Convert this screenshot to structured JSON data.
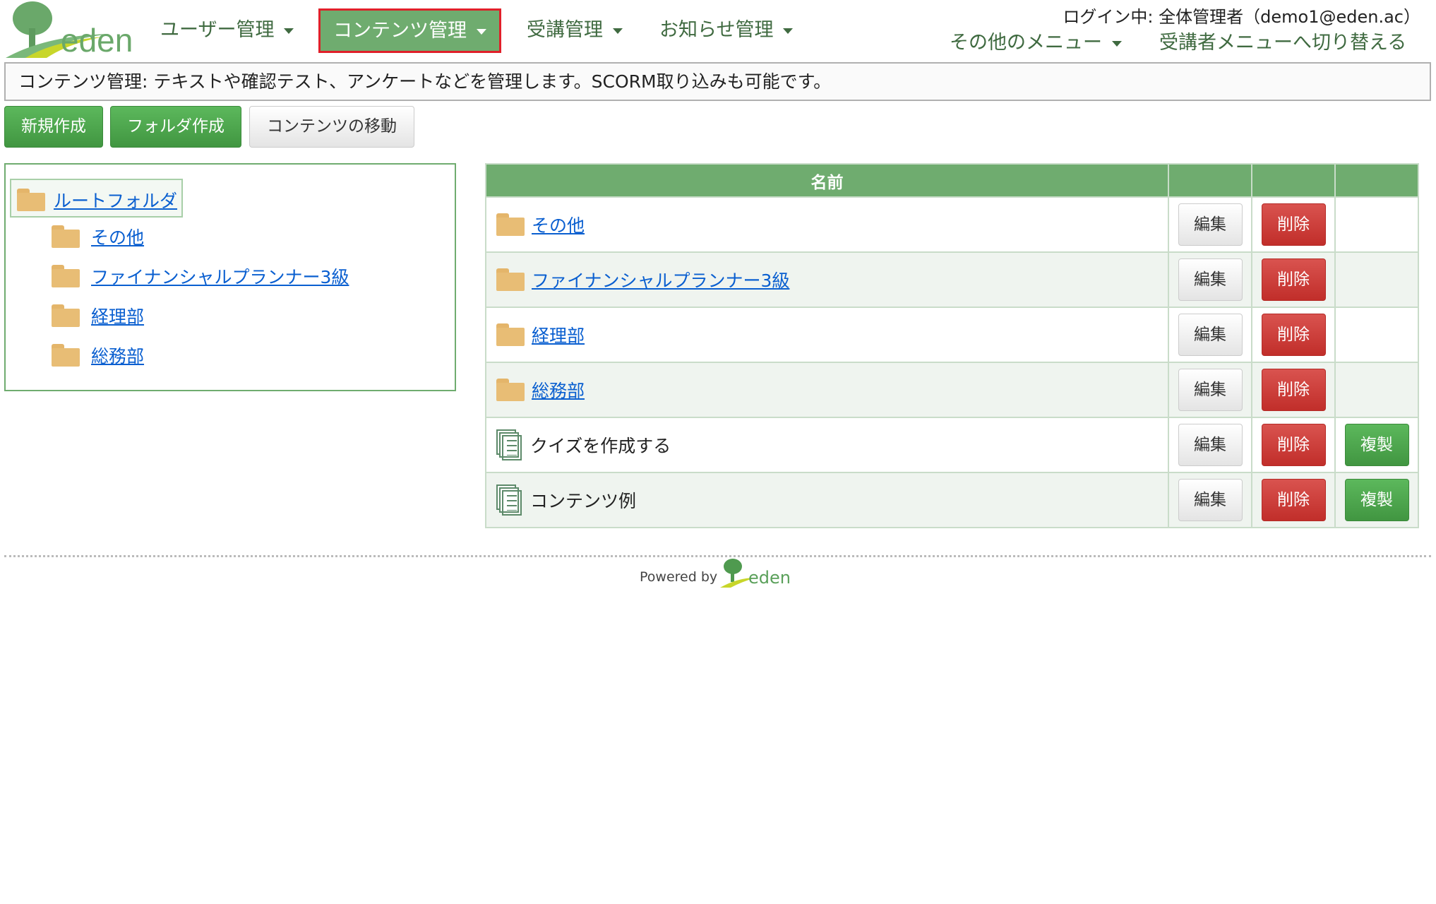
{
  "brand": {
    "logo_text": "eden"
  },
  "nav": {
    "items": [
      {
        "label": "ユーザー管理"
      },
      {
        "label": "コンテンツ管理",
        "active": true
      },
      {
        "label": "受講管理"
      },
      {
        "label": "お知らせ管理"
      }
    ],
    "login_status": "ログイン中: 全体管理者（demo1@eden.ac）",
    "other_menu": "その他のメニュー",
    "switch_menu": "受講者メニューへ切り替える"
  },
  "description": "コンテンツ管理: テキストや確認テスト、アンケートなどを管理します。SCORM取り込みも可能です。",
  "toolbar": {
    "new": "新規作成",
    "new_folder": "フォルダ作成",
    "move": "コンテンツの移動"
  },
  "tree": {
    "root": "ルートフォルダ",
    "children": [
      "その他",
      "ファイナンシャルプランナー3級",
      "経理部",
      "総務部"
    ]
  },
  "table": {
    "header": "名前",
    "edit": "編集",
    "delete": "削除",
    "copy": "複製",
    "rows": [
      {
        "name": "その他",
        "type": "folder"
      },
      {
        "name": "ファイナンシャルプランナー3級",
        "type": "folder"
      },
      {
        "name": "経理部",
        "type": "folder"
      },
      {
        "name": "総務部",
        "type": "folder"
      },
      {
        "name": "クイズを作成する",
        "type": "content"
      },
      {
        "name": "コンテンツ例",
        "type": "content"
      }
    ]
  },
  "footer": {
    "powered_by": "Powered by",
    "logo_text": "eden"
  }
}
